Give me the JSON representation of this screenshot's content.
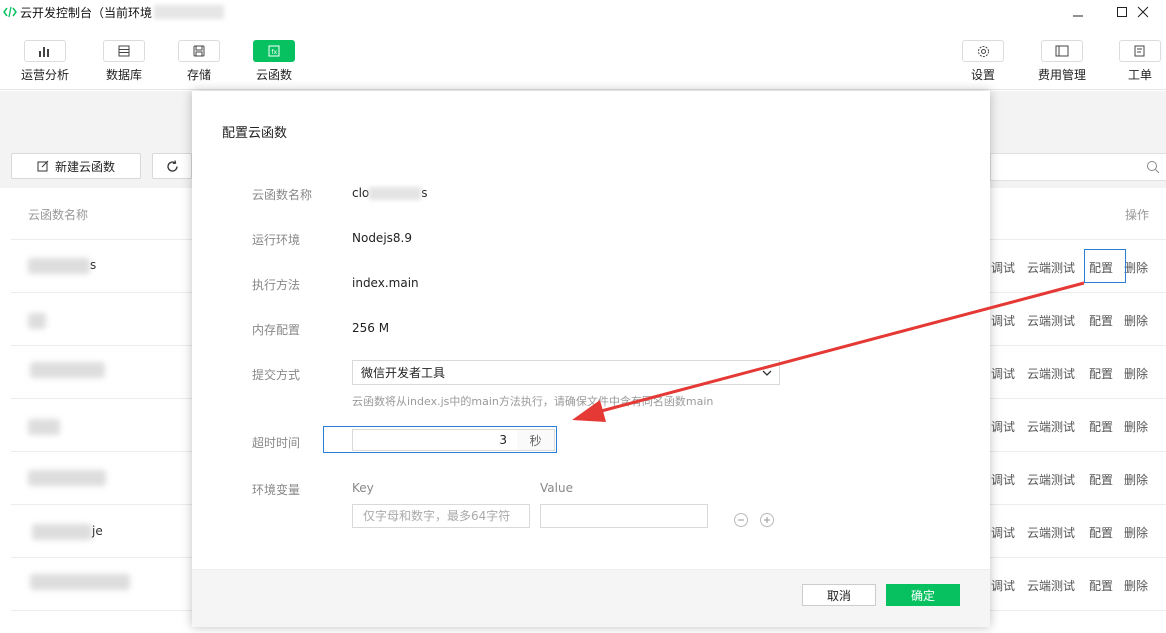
{
  "window": {
    "title": "云开发控制台（当前环境",
    "controls": [
      "minimize",
      "maximize",
      "close"
    ]
  },
  "toolbar": {
    "left": [
      {
        "label": "运营分析",
        "icon": "bar-chart-icon"
      },
      {
        "label": "数据库",
        "icon": "database-icon"
      },
      {
        "label": "存储",
        "icon": "storage-icon"
      },
      {
        "label": "云函数",
        "icon": "function-icon",
        "active": true
      }
    ],
    "right": [
      {
        "label": "设置",
        "icon": "gear-icon"
      },
      {
        "label": "费用管理",
        "icon": "billing-icon"
      },
      {
        "label": "工单",
        "icon": "ticket-icon"
      }
    ]
  },
  "list": {
    "new_button": "新建云函数",
    "col_name": "云函数名称",
    "col_ops": "操作",
    "row_ops": [
      "调试",
      "云端测试",
      "配置",
      "删除"
    ],
    "row_fragments": [
      "s",
      "",
      "",
      "",
      "",
      "je",
      "",
      ""
    ]
  },
  "modal": {
    "title": "配置云函数",
    "fields": {
      "name_label": "云函数名称",
      "name_value_start": "clo",
      "name_value_end": "s",
      "runtime_label": "运行环境",
      "runtime_value": "Nodejs8.9",
      "handler_label": "执行方法",
      "handler_value": "index.main",
      "memory_label": "内存配置",
      "memory_value": "256 M",
      "submit_label": "提交方式",
      "submit_value": "微信开发者工具",
      "submit_hint": "云函数将从index.js中的main方法执行，请确保文件中含有同名函数main",
      "timeout_label": "超时时间",
      "timeout_value": "3",
      "timeout_unit": "秒",
      "env_label": "环境变量",
      "key_label": "Key",
      "value_label": "Value",
      "key_placeholder": "仅字母和数字，最多64字符"
    },
    "cancel_label": "取消",
    "ok_label": "确定"
  },
  "colors": {
    "accent": "#07c160",
    "highlight_border": "#2d7dd2",
    "arrow": "#e53935"
  }
}
